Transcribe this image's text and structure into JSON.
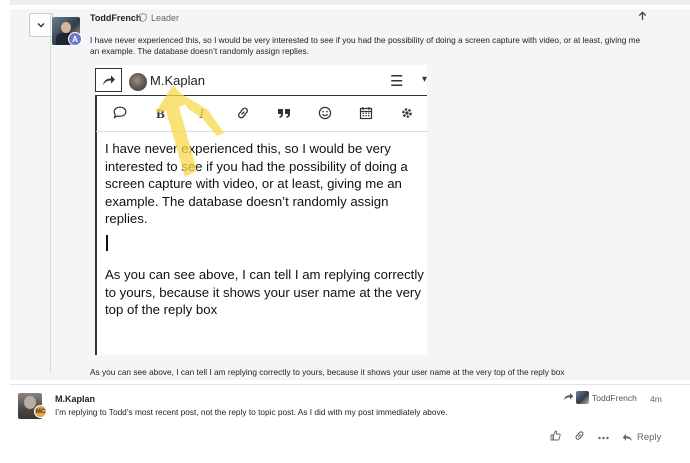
{
  "post1": {
    "author": "ToddFrench",
    "role": "Leader",
    "avatar_badge": "A",
    "body": "I have never experienced this, so I would be very interested to see if you had the possibility of doing a screen capture with video, or at least, giving me an example. The database doesn’t randomly assign replies.",
    "caption": "As you can see above, I can tell I am replying correctly to yours, because it shows your user name at the very top of the reply box",
    "icons": {
      "collapse": "chevron-down-icon",
      "shield": "shield-icon",
      "top": "arrow-up-icon"
    }
  },
  "screenshot": {
    "user": "M.Kaplan",
    "paragraph1": "I have never experienced this, so I would be very interested to see if you had the possibility of doing a screen capture with video, or at least, giving me an example. The database doesn’t randomly assign replies.",
    "paragraph2": "As you can see above, I can tell I am replying correctly to yours, because it shows your user name at the very top of the reply box",
    "toolbar_bold": "B",
    "toolbar_italic": "I",
    "highlight_color": "#f7d94c"
  },
  "post2": {
    "author": "M.Kaplan",
    "avatar_badge": "MC",
    "body": "I’m replying to Todd’s most recent post, not the reply to topic post. As I did with my post immediately above.",
    "reply_to_user": "ToddFrench",
    "time": "4m",
    "reply_label": "Reply"
  }
}
